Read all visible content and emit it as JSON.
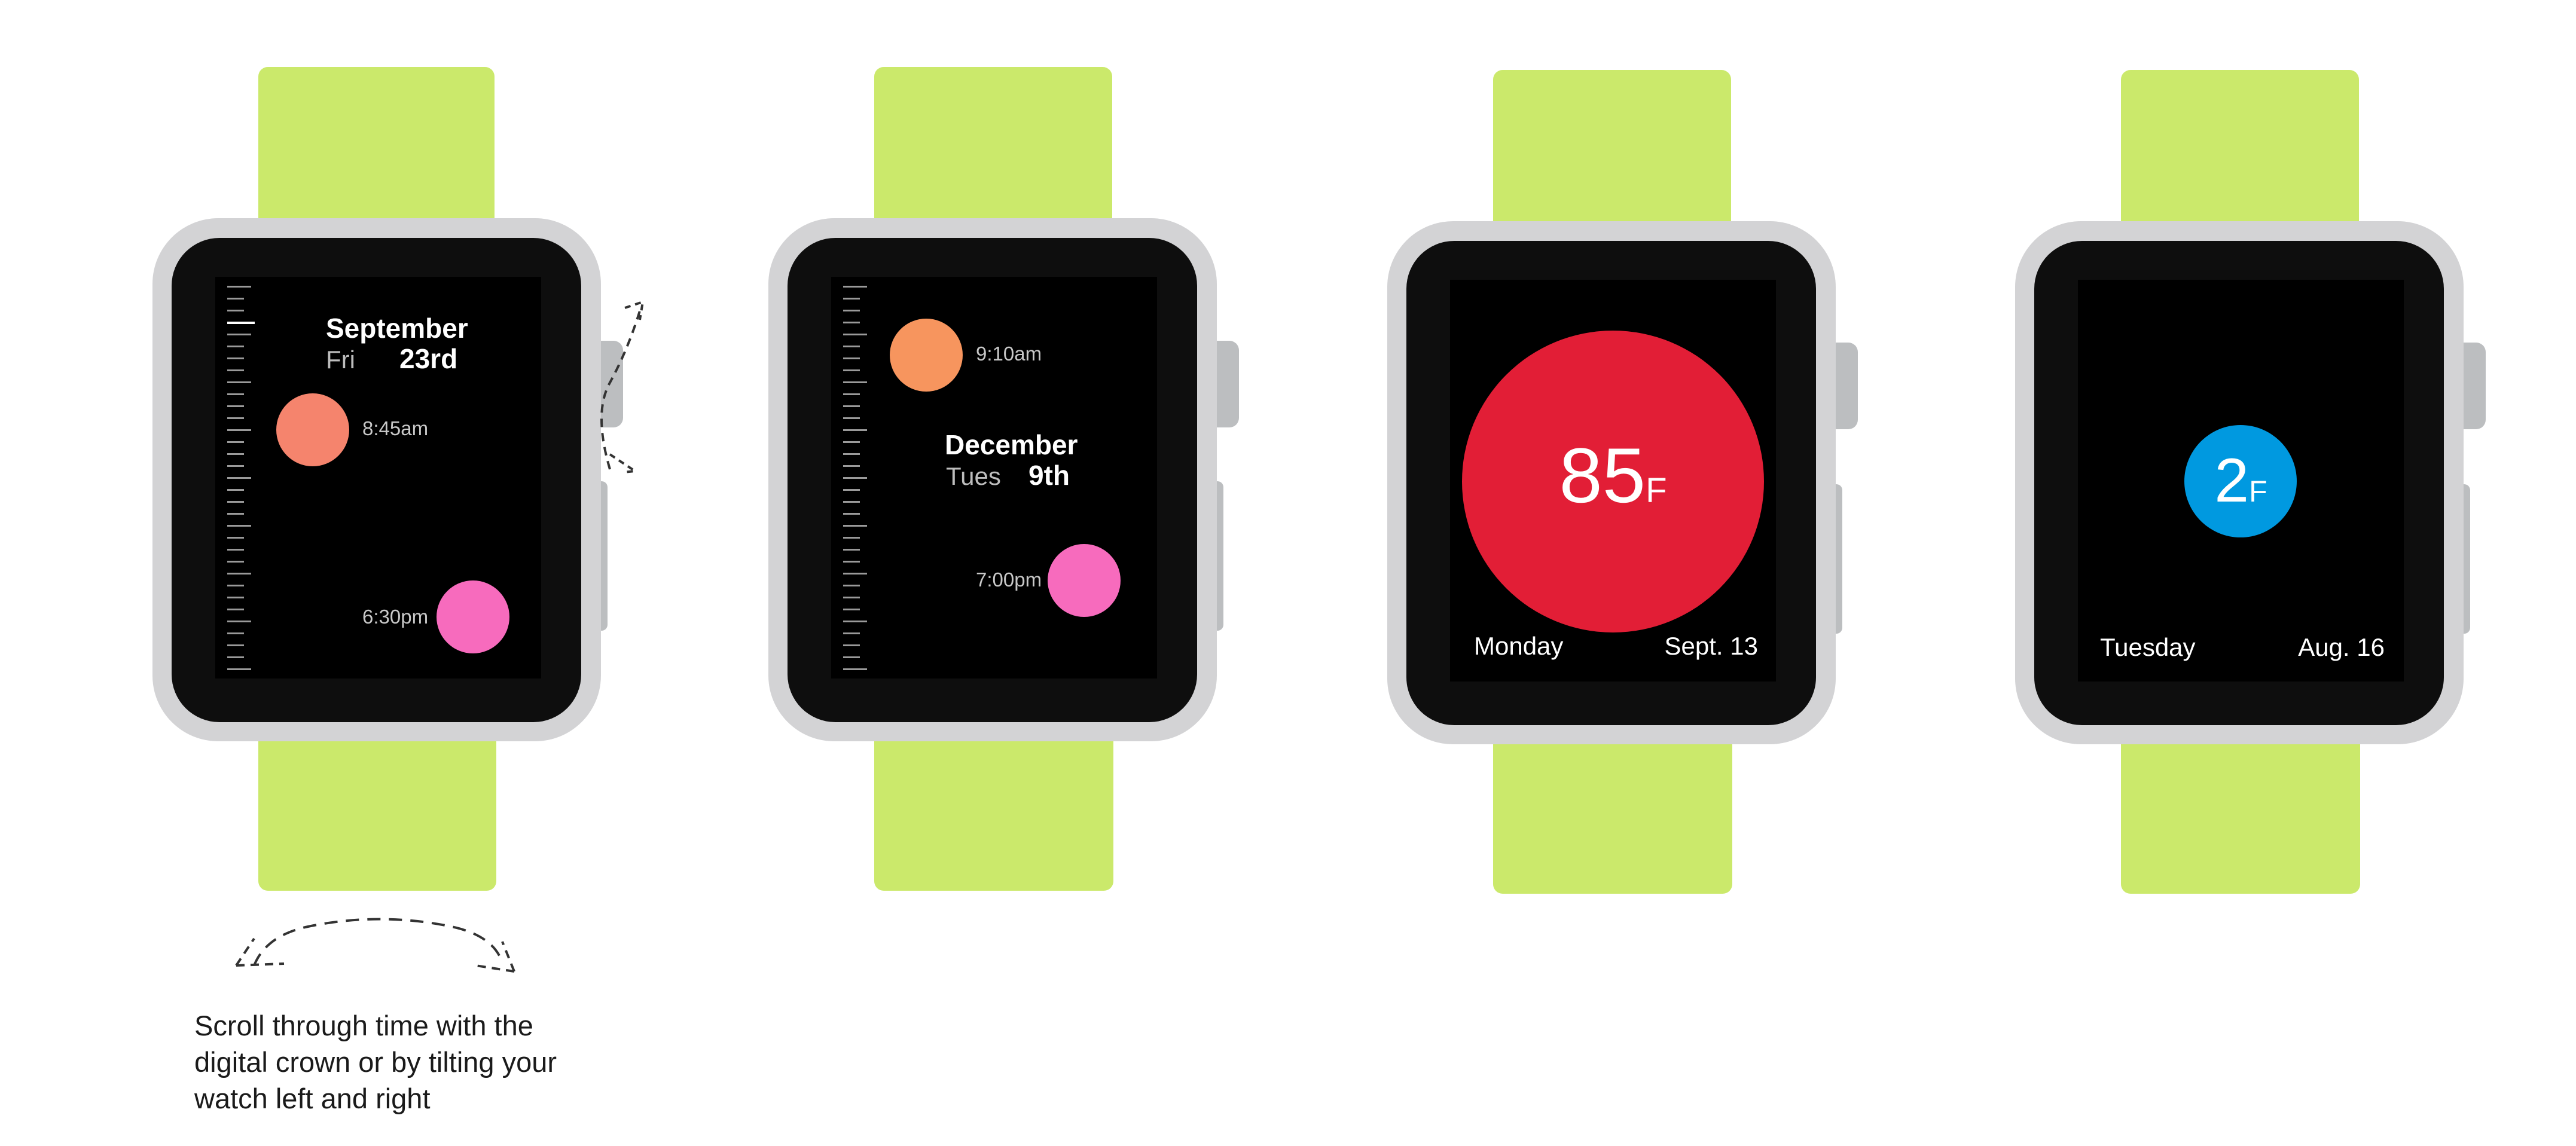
{
  "colors": {
    "band": "#cbe96b",
    "case": "#d3d3d5",
    "bezel": "#0e0e0e",
    "screen": "#000000",
    "hot": "#e21e36",
    "cold": "#0099e0",
    "peach": "#f5846d",
    "orange": "#f7955e",
    "pink": "#f76bbd"
  },
  "watch1": {
    "month": "September",
    "weekday": "Fri",
    "day": "23rd",
    "event1_time": "8:45am",
    "event2_time": "6:30pm"
  },
  "watch2": {
    "month": "December",
    "weekday": "Tues",
    "day": "9th",
    "event1_time": "9:10am",
    "event2_time": "7:00pm"
  },
  "watch3": {
    "temperature": "85",
    "unit": "F",
    "weekday": "Monday",
    "date": "Sept. 13"
  },
  "watch4": {
    "temperature": "2",
    "unit": "F",
    "weekday": "Tuesday",
    "date": "Aug. 16"
  },
  "caption": {
    "line1": "Scroll through time with the",
    "line2": "digital crown or by tilting your",
    "line3": "watch left and right"
  }
}
